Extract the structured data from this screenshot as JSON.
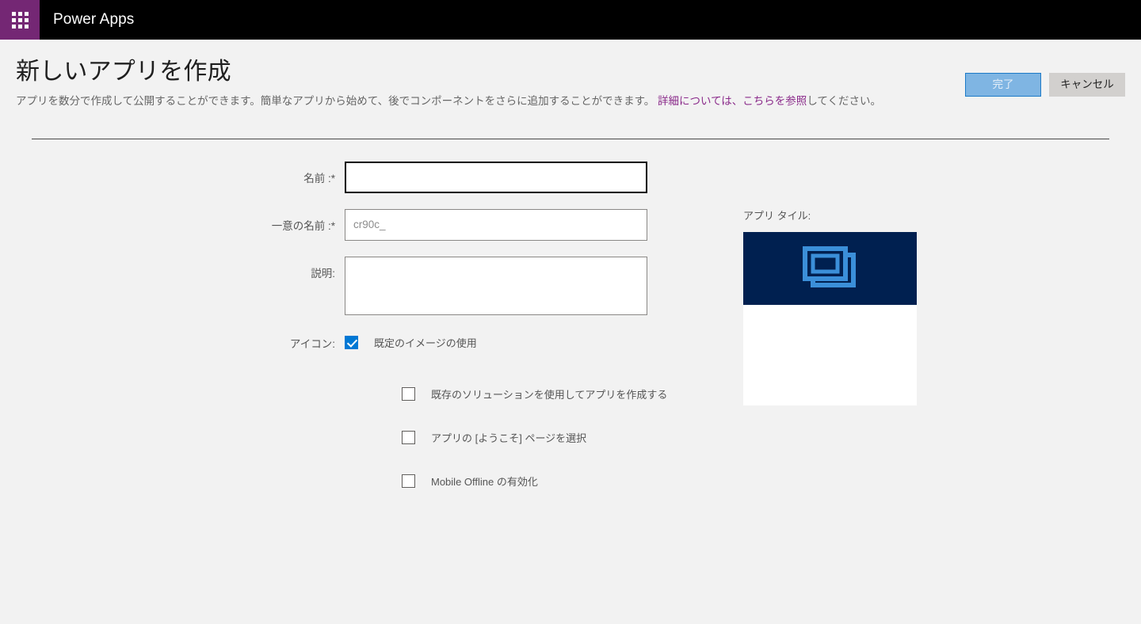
{
  "suite": {
    "waffle_icon": "waffle-grid-icon",
    "title": "Power Apps"
  },
  "header": {
    "title": "新しいアプリを作成",
    "description_part1": "アプリを数分で作成して公開することができます。簡単なアプリから始めて、後でコンポーネントをさらに追加することができます。",
    "description_link": "詳細については、こちらを参照",
    "description_part2": "してください。",
    "done_label": "完了",
    "cancel_label": "キャンセル",
    "done_enabled": false
  },
  "form": {
    "name": {
      "label": "名前 :*",
      "value": "",
      "placeholder": "",
      "focused": true
    },
    "unique_name": {
      "label": "一意の名前 :*",
      "value": "",
      "placeholder": "cr90c_"
    },
    "description": {
      "label": "説明:",
      "value": "",
      "placeholder": ""
    },
    "icon": {
      "label": "アイコン:",
      "checkbox_label": "既定のイメージの使用",
      "checked": true
    },
    "options": [
      {
        "label": "既存のソリューションを使用してアプリを作成する",
        "checked": false
      },
      {
        "label": "アプリの [ようこそ] ページを選択",
        "checked": false
      },
      {
        "label": "Mobile Offline の有効化",
        "checked": false
      }
    ]
  },
  "tile": {
    "caption": "アプリ タイル:",
    "icon": "stacked-windows-icon",
    "header_color": "#002050",
    "icon_color": "#3b8fd9",
    "body_color": "#ffffff"
  },
  "colors": {
    "waffle_purple": "#742774",
    "link_purple": "#8a2a8a",
    "accent_blue": "#0078d4",
    "page_background": "#f2f2f2"
  }
}
